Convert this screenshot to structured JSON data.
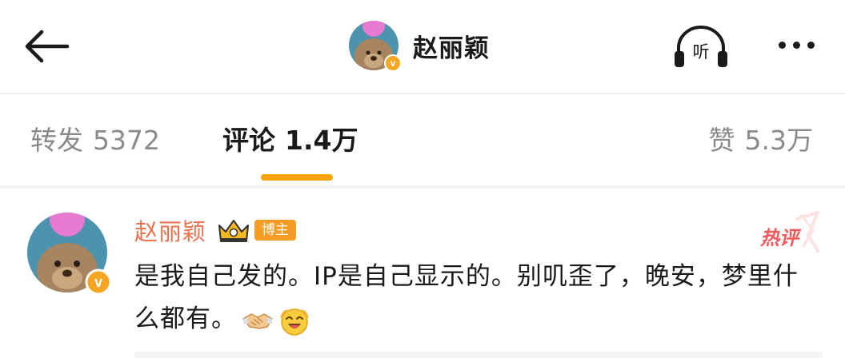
{
  "header": {
    "title": "赵丽颖",
    "listen_label": "听",
    "verified_mark": "v"
  },
  "tabs": {
    "repost": {
      "label": "转发",
      "count": "5372"
    },
    "comment": {
      "label": "评论",
      "count": "1.4万"
    },
    "like": {
      "label": "赞",
      "count": "5.3万"
    }
  },
  "comment": {
    "author": "赵丽颖",
    "verified_mark": "v",
    "badge": "博主",
    "hot_label": "热评",
    "text": "是我自己发的。IP是自己显示的。别叽歪了，晚安，梦里什么都有。",
    "emojis": [
      "handshake-emoji",
      "laughing-emoji"
    ]
  },
  "colors": {
    "accent": "#f7a400",
    "name": "#eb7350",
    "badge": "#f69b23",
    "hot": "#f25a5a",
    "muted": "#8a8a8a"
  }
}
